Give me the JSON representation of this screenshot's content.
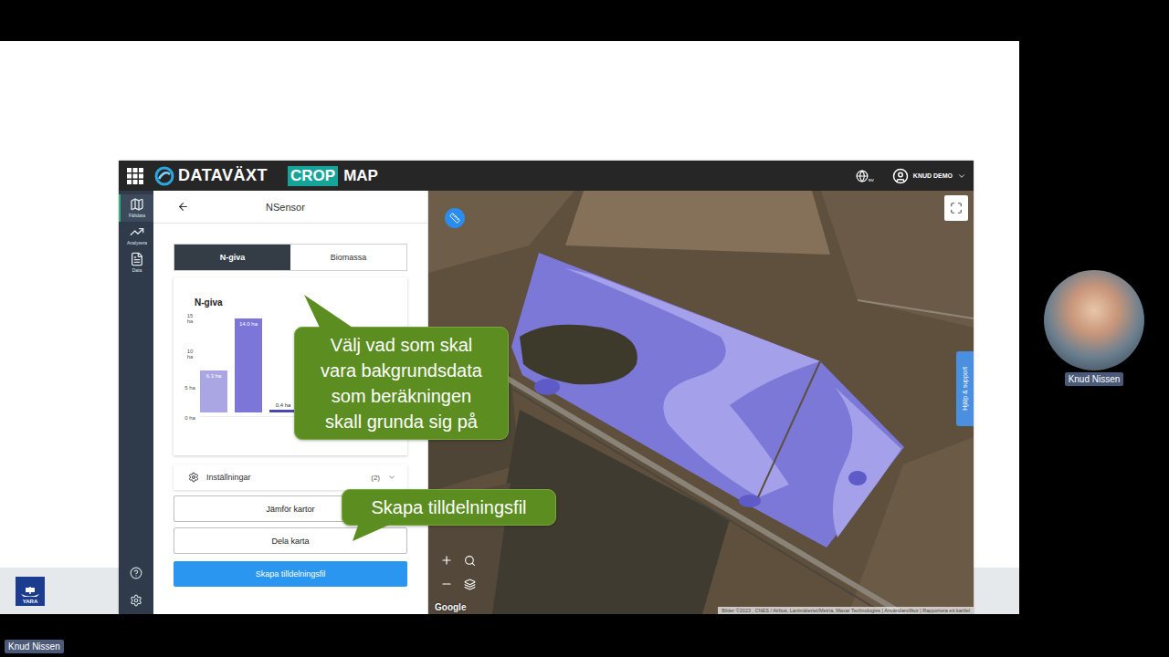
{
  "app": {
    "brand": "DATAVÄXT",
    "product": [
      "CROP",
      "MAP"
    ],
    "language": "sv",
    "user": "KNUD DEMO"
  },
  "sidebar": [
    {
      "label": "Fältdata",
      "selected": true
    },
    {
      "label": "Analysera",
      "selected": false
    },
    {
      "label": "Data",
      "selected": false
    }
  ],
  "panel": {
    "title": "NSensor",
    "tabs": [
      {
        "label": "N-giva",
        "selected": true
      },
      {
        "label": "Biomassa",
        "selected": false
      }
    ],
    "chart": {
      "title": "N-giva",
      "y_ticks": [
        "15 ha",
        "10 ha",
        "5 ha",
        "0 ha"
      ],
      "values": [
        6.3,
        14.0,
        0.4
      ],
      "value_labels": [
        "6.3 ha",
        "14.0 ha",
        "0.4 ha"
      ],
      "colors": [
        "#aaa6e4",
        "#7c76d8",
        "#4b45b0"
      ]
    },
    "settings": {
      "label": "Inställningar",
      "count": "(2)",
      "expanded": false
    },
    "buttons": [
      "Jämför kartor",
      "Dela karta"
    ],
    "primary_button": "Skapa tilldelningsfil"
  },
  "map": {
    "help_tab": "Hjälp & support",
    "watermark": "Google",
    "attribution": "Bilder ©2023 , CNES / Airbus, Lantmäteriet/Metria, Maxar Technologies | Användarvillkor | Rapportera ett kartfel"
  },
  "callouts": [
    {
      "lines": [
        "Välj vad som skal",
        "vara bakgrundsdata",
        "som beräkningen",
        "skall grunda sig på"
      ]
    },
    {
      "lines": [
        "Skapa tilldelningsfil"
      ]
    }
  ],
  "footer_logo": "YARA",
  "participant": {
    "name": "Knud Nissen"
  },
  "presenter_label": "Knud Nissen"
}
